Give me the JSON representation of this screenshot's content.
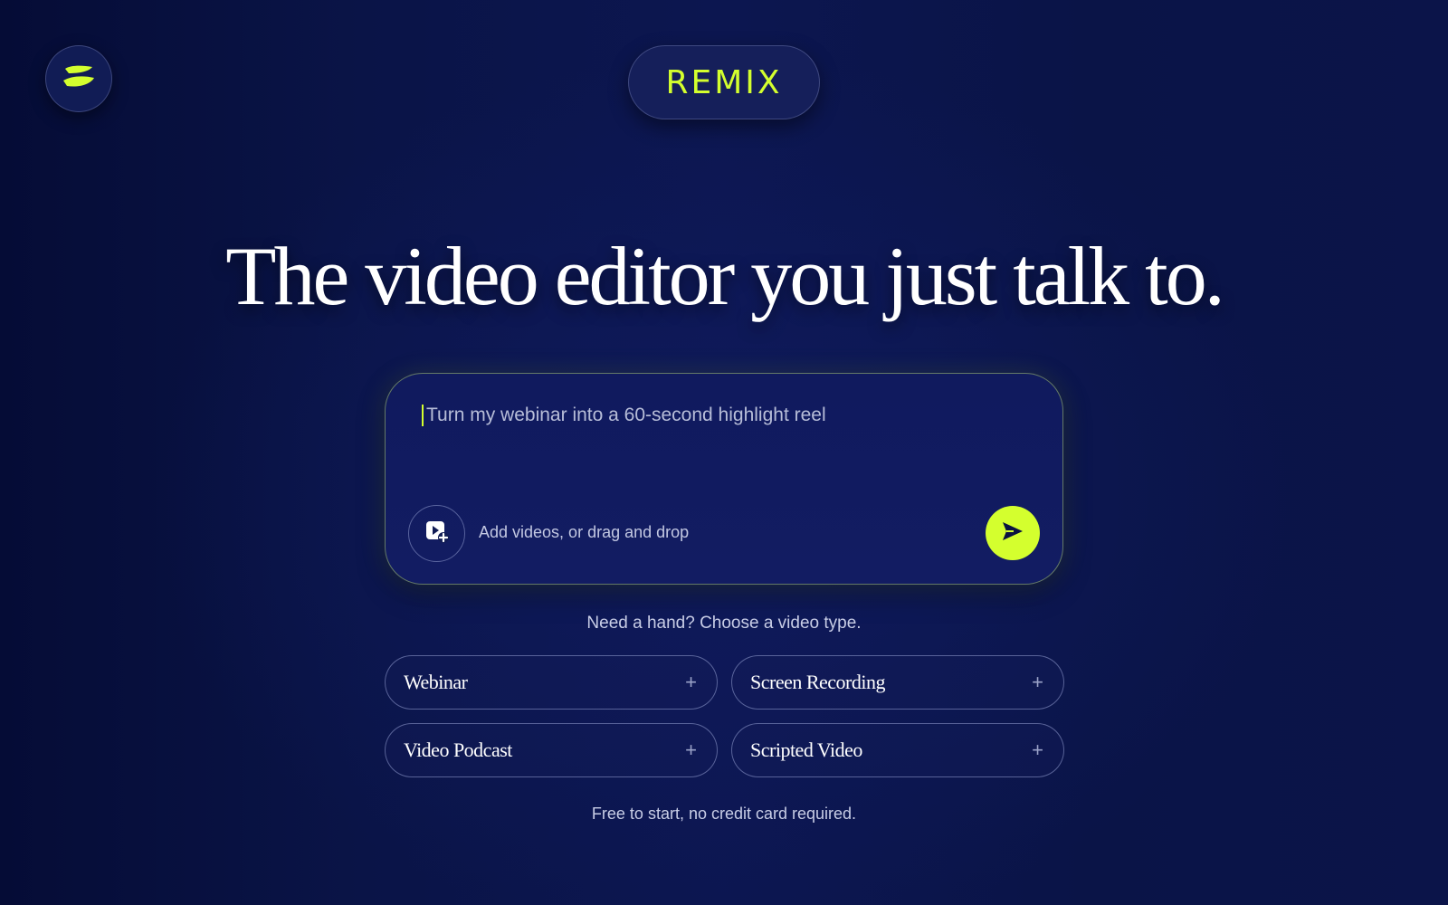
{
  "brand": {
    "name": "REMIX",
    "logo_icon": "wix-logo-icon",
    "accent_color": "#d4ff2e"
  },
  "headline": "The video editor you just talk to.",
  "prompt": {
    "placeholder": "Turn my webinar into a 60-second highlight reel",
    "add_videos_label": "Add videos, or drag and drop",
    "add_video_icon": "video-add-icon",
    "send_icon": "send-icon"
  },
  "helper_text": "Need a hand? Choose a video type.",
  "video_types": [
    {
      "label": "Webinar",
      "icon": "plus-icon"
    },
    {
      "label": "Screen Recording",
      "icon": "plus-icon"
    },
    {
      "label": "Video Podcast",
      "icon": "plus-icon"
    },
    {
      "label": "Scripted Video",
      "icon": "plus-icon"
    }
  ],
  "footer_note": "Free to start, no credit card required."
}
